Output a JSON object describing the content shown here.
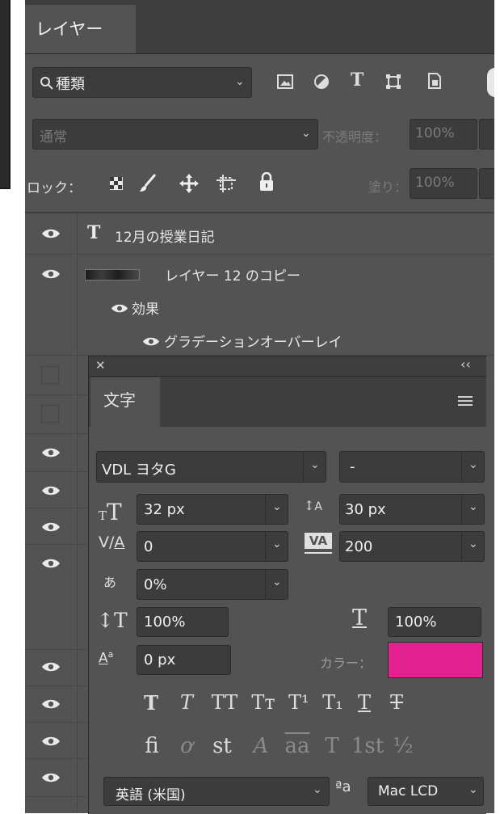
{
  "layers_panel": {
    "tab_label": "レイヤー",
    "filter": {
      "label": "種類"
    },
    "blend_mode": "通常",
    "opacity_label": "不透明度：",
    "opacity_value": "100%",
    "lock_label": "ロック：",
    "fill_label": "塗り：",
    "fill_value": "100%",
    "layers": [
      {
        "name": "12月の授業日記",
        "type": "text"
      },
      {
        "name": "レイヤー 12 のコピー",
        "type": "image"
      }
    ],
    "effects_label": "効果",
    "effect_item": "グラデーションオーバーレイ"
  },
  "character_panel": {
    "tab_label": "文字",
    "font_family": "VDL ヨタG",
    "font_style": "-",
    "font_size": "32 px",
    "leading": "30 px",
    "kerning": "0",
    "tracking": "200",
    "tsume": "0%",
    "vertical_scale": "100%",
    "horizontal_scale": "100%",
    "baseline_shift": "0 px",
    "color_label": "カラー：",
    "color_value": "#e5218f",
    "style_buttons": [
      "T",
      "T",
      "TT",
      "Tт",
      "T¹",
      "T₁",
      "T",
      "T"
    ],
    "opentype_buttons": [
      "ﬁ",
      "ơ",
      "st",
      "A",
      "aa",
      "T",
      "1st",
      "½"
    ],
    "language": "英語 (米国)",
    "aa_icon": "ªa",
    "antialias": "Mac LCD"
  }
}
